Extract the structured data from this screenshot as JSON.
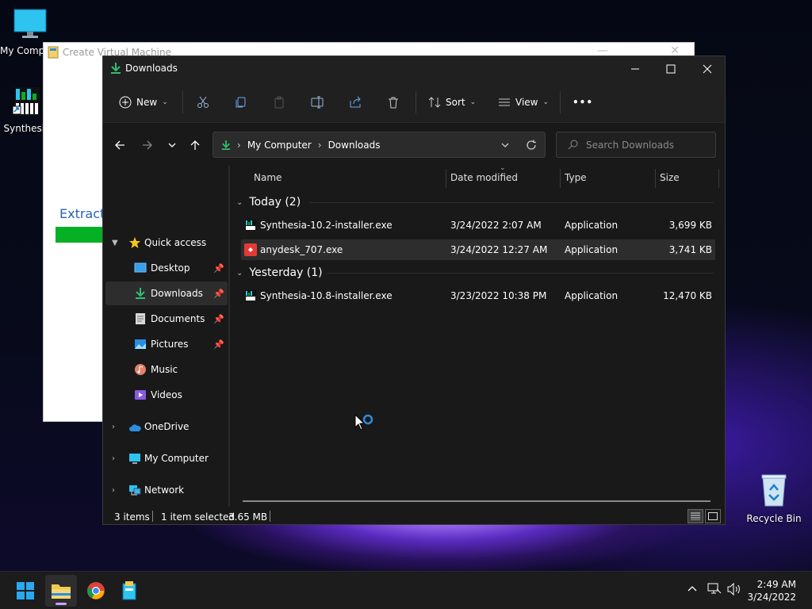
{
  "desktop": {
    "icons": [
      {
        "label": "My Computer"
      },
      {
        "label": "Synthesia"
      },
      {
        "label": "Recycle Bin"
      }
    ]
  },
  "background_window": {
    "title": "Create Virtual Machine",
    "extract_text": "Extract",
    "progress_color": "#06b025"
  },
  "explorer": {
    "title": "Downloads",
    "toolbar": {
      "new_label": "New",
      "sort_label": "Sort",
      "view_label": "View",
      "more_label": "•••"
    },
    "address": {
      "crumbs": [
        "My Computer",
        "Downloads"
      ]
    },
    "search": {
      "placeholder": "Search Downloads"
    },
    "sidebar": {
      "quick_access": "Quick access",
      "items": [
        {
          "label": "Desktop"
        },
        {
          "label": "Downloads"
        },
        {
          "label": "Documents"
        },
        {
          "label": "Pictures"
        },
        {
          "label": "Music"
        },
        {
          "label": "Videos"
        }
      ],
      "onedrive": "OneDrive",
      "my_computer": "My Computer",
      "network": "Network"
    },
    "columns": {
      "name": "Name",
      "date": "Date modified",
      "type": "Type",
      "size": "Size"
    },
    "groups": [
      {
        "label": "Today (2)",
        "files": [
          {
            "name": "Synthesia-10.2-installer.exe",
            "date": "3/24/2022 2:07 AM",
            "type": "Application",
            "size": "3,699 KB"
          },
          {
            "name": "anydesk_707.exe",
            "date": "3/24/2022 12:27 AM",
            "type": "Application",
            "size": "3,741 KB"
          }
        ]
      },
      {
        "label": "Yesterday (1)",
        "files": [
          {
            "name": "Synthesia-10.8-installer.exe",
            "date": "3/23/2022 10:38 PM",
            "type": "Application",
            "size": "12,470 KB"
          }
        ]
      }
    ],
    "status": {
      "items": "3 items",
      "selected": "1 item selected",
      "size": "3.65 MB"
    }
  },
  "taskbar": {
    "time": "2:49 AM",
    "date": "3/24/2022"
  },
  "colors": {
    "accent": "#0078d4",
    "download_green": "#2fbf71"
  }
}
